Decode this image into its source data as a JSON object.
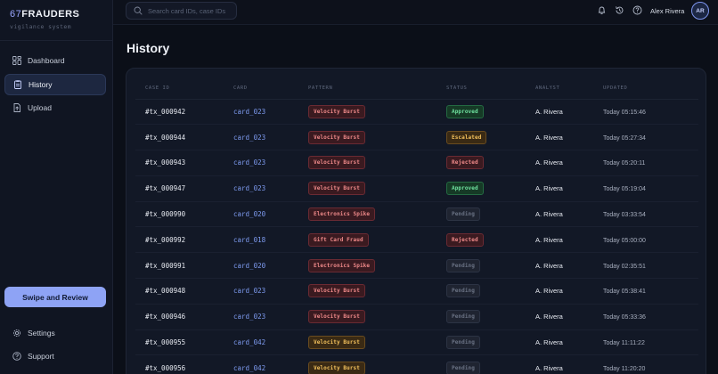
{
  "brand": {
    "number": "67",
    "name": "FRAUDERS",
    "subtitle": "vigilance system"
  },
  "sidebar": {
    "items": [
      {
        "label": "Dashboard",
        "icon": "dashboard-icon",
        "active": false
      },
      {
        "label": "History",
        "icon": "history-icon",
        "active": true
      },
      {
        "label": "Upload",
        "icon": "upload-icon",
        "active": false
      }
    ],
    "cta_label": "Swipe and Review",
    "footer": [
      {
        "label": "Settings",
        "icon": "gear-icon"
      },
      {
        "label": "Support",
        "icon": "help-icon"
      }
    ]
  },
  "topbar": {
    "search_placeholder": "Search card IDs, case IDs",
    "user_name": "Alex Rivera",
    "avatar_initials": "AR"
  },
  "page": {
    "title": "History"
  },
  "table": {
    "headers": [
      "CASE ID",
      "CARD",
      "PATTERN",
      "STATUS",
      "ANALYST",
      "UPDATED"
    ],
    "rows": [
      {
        "case": "#tx_000942",
        "card": "card_023",
        "pattern": "Velocity Burst",
        "pattern_tone": "red",
        "status": "Approved",
        "analyst": "A. Rivera",
        "updated": "Today 05:15:46"
      },
      {
        "case": "#tx_000944",
        "card": "card_023",
        "pattern": "Velocity Burst",
        "pattern_tone": "red",
        "status": "Escalated",
        "analyst": "A. Rivera",
        "updated": "Today 05:27:34"
      },
      {
        "case": "#tx_000943",
        "card": "card_023",
        "pattern": "Velocity Burst",
        "pattern_tone": "red",
        "status": "Rejected",
        "analyst": "A. Rivera",
        "updated": "Today 05:20:11"
      },
      {
        "case": "#tx_000947",
        "card": "card_023",
        "pattern": "Velocity Burst",
        "pattern_tone": "red",
        "status": "Approved",
        "analyst": "A. Rivera",
        "updated": "Today 05:19:04"
      },
      {
        "case": "#tx_000990",
        "card": "card_020",
        "pattern": "Electronics Spike",
        "pattern_tone": "red",
        "status": "Pending",
        "analyst": "A. Rivera",
        "updated": "Today 03:33:54"
      },
      {
        "case": "#tx_000992",
        "card": "card_018",
        "pattern": "Gift Card Fraud",
        "pattern_tone": "red",
        "status": "Rejected",
        "analyst": "A. Rivera",
        "updated": "Today 05:00:00"
      },
      {
        "case": "#tx_000991",
        "card": "card_020",
        "pattern": "Electronics Spike",
        "pattern_tone": "red",
        "status": "Pending",
        "analyst": "A. Rivera",
        "updated": "Today 02:35:51"
      },
      {
        "case": "#tx_000948",
        "card": "card_023",
        "pattern": "Velocity Burst",
        "pattern_tone": "red",
        "status": "Pending",
        "analyst": "A. Rivera",
        "updated": "Today 05:38:41"
      },
      {
        "case": "#tx_000946",
        "card": "card_023",
        "pattern": "Velocity Burst",
        "pattern_tone": "red",
        "status": "Pending",
        "analyst": "A. Rivera",
        "updated": "Today 05:33:36"
      },
      {
        "case": "#tx_000955",
        "card": "card_042",
        "pattern": "Velocity Burst",
        "pattern_tone": "amber",
        "status": "Pending",
        "analyst": "A. Rivera",
        "updated": "Today 11:11:22"
      },
      {
        "case": "#tx_000956",
        "card": "card_042",
        "pattern": "Velocity Burst",
        "pattern_tone": "amber",
        "status": "Pending",
        "analyst": "A. Rivera",
        "updated": "Today 11:20:20"
      }
    ]
  },
  "colors": {
    "accent": "#8ea3f5",
    "background": "#0b0f18",
    "card_link": "#7e9bf0"
  }
}
